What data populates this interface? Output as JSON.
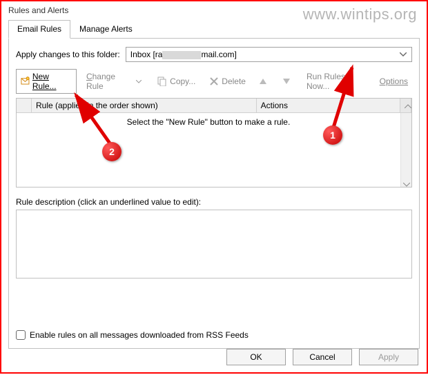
{
  "window": {
    "title": "Rules and Alerts"
  },
  "tabs": {
    "email_rules": "Email Rules",
    "manage_alerts": "Manage Alerts"
  },
  "folder": {
    "label": "Apply changes to this folder:",
    "value_prefix": "Inbox [ra",
    "value_suffix": "mail.com]"
  },
  "toolbar": {
    "new_rule": "New Rule...",
    "change_rule": "Change Rule",
    "copy": "Copy...",
    "delete": "Delete",
    "run_now": "Run Rules Now...",
    "options": "Options"
  },
  "grid": {
    "col_rule": "Rule (applied in the order shown)",
    "col_actions": "Actions",
    "empty_msg": "Select the \"New Rule\" button to make a rule."
  },
  "description": {
    "label": "Rule description (click an underlined value to edit):"
  },
  "rss": {
    "label": "Enable rules on all messages downloaded from RSS Feeds"
  },
  "buttons": {
    "ok": "OK",
    "cancel": "Cancel",
    "apply": "Apply"
  },
  "watermark": "www.wintips.org",
  "annotations": {
    "one": "1",
    "two": "2"
  }
}
